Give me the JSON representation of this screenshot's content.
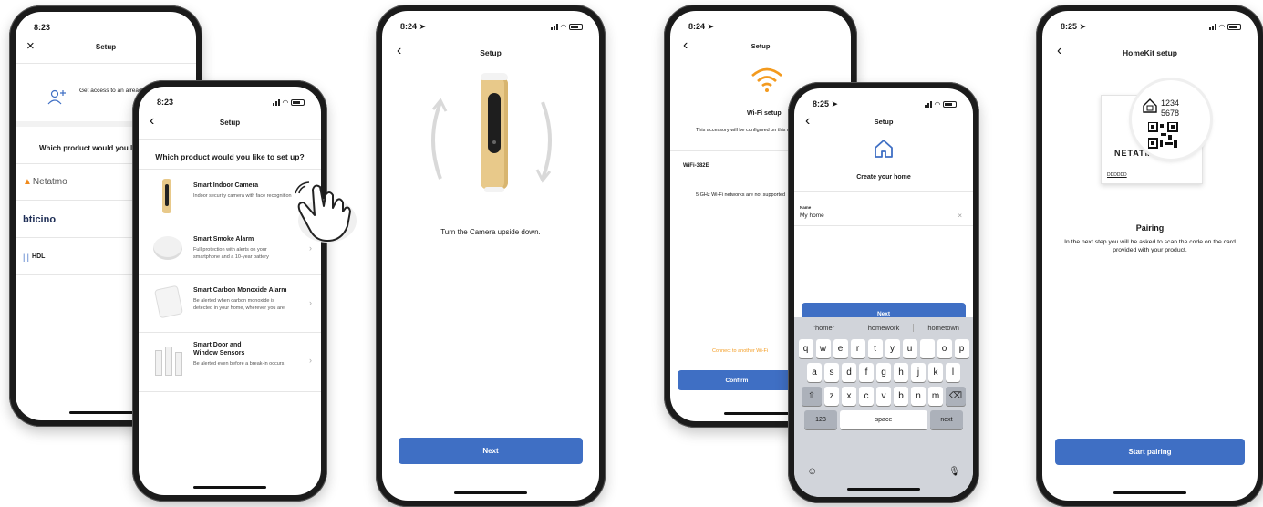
{
  "p1": {
    "time": "8:23",
    "title": "Setup",
    "close": "×",
    "access_text": "Get access to an already installed product",
    "question": "Which product would you like to set up?",
    "brands": [
      "Netatmo",
      "bticino",
      "HDL"
    ]
  },
  "p2": {
    "time": "8:23",
    "title": "Setup",
    "question": "Which product would you like to set up?",
    "products": [
      {
        "name": "Smart Indoor Camera",
        "desc": "Indoor security camera with face recognition"
      },
      {
        "name": "Smart Smoke Alarm",
        "desc": "Full protection with alerts on your smartphone and a 10-year battery"
      },
      {
        "name": "Smart Carbon Monoxide Alarm",
        "desc": "Be alerted when carbon monoxide is detected in your home, wherever you are"
      },
      {
        "name": "Smart Door and Window Sensors",
        "desc": "Be alerted even before a break-in occurs"
      }
    ]
  },
  "p3": {
    "time": "8:24",
    "title": "Setup",
    "instruction": "Turn the Camera upside down.",
    "next": "Next"
  },
  "p4": {
    "time": "8:24",
    "title": "Setup",
    "wifi_title": "Wi-Fi setup",
    "wifi_desc": "This accessory will be configured on this network:",
    "network": "WiFi-382E",
    "ghz_note": "5 GHz Wi-Fi networks are not supported",
    "connect_other": "Connect to another Wi-Fi",
    "confirm": "Confirm"
  },
  "p5": {
    "time": "8:25",
    "title": "Setup",
    "heading": "Create your home",
    "name_label": "Name",
    "name_value": "My home",
    "next": "Next",
    "suggestions": [
      "\"home\"",
      "homework",
      "hometown"
    ],
    "row1": [
      "q",
      "w",
      "e",
      "r",
      "t",
      "y",
      "u",
      "i",
      "o",
      "p"
    ],
    "row2": [
      "a",
      "s",
      "d",
      "f",
      "g",
      "h",
      "j",
      "k",
      "l"
    ],
    "row3": [
      "z",
      "x",
      "c",
      "v",
      "b",
      "n",
      "m"
    ],
    "num_key": "123",
    "space_key": "space",
    "next_key": "next"
  },
  "p6": {
    "time": "8:25",
    "title": "HomeKit setup",
    "code_line1": "1234",
    "code_line2": "5678",
    "card_brand": "NETATMO",
    "card_serial": "DDDDDD",
    "heading": "Pairing",
    "desc": "In the next step you will be asked to scan the code on the card provided with your product.",
    "start": "Start pairing"
  },
  "colors": {
    "accent_blue": "#3f6fc4",
    "wifi_orange": "#f39a1e",
    "camera_gold": "#e8c98a",
    "netatmo_orange": "#f08a1c"
  }
}
